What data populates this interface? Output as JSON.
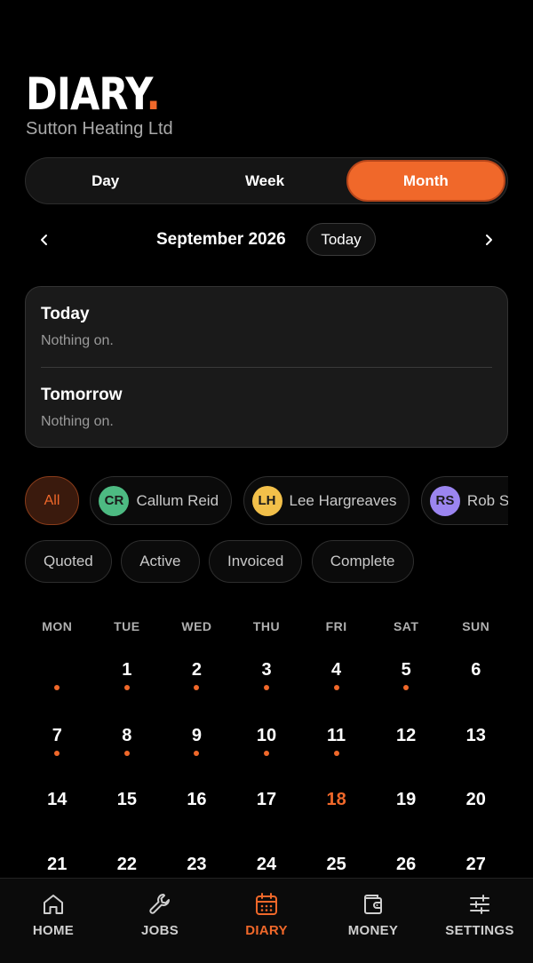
{
  "header": {
    "brand": "DIARY",
    "brand_dot": ".",
    "company": "Sutton Heating Ltd"
  },
  "view_toggle": {
    "options": [
      "Day",
      "Week",
      "Month"
    ],
    "active": "Month"
  },
  "month_nav": {
    "title": "September 2026",
    "today_label": "Today"
  },
  "summary": [
    {
      "label": "Today",
      "text": "Nothing on."
    },
    {
      "label": "Tomorrow",
      "text": "Nothing on."
    }
  ],
  "staff_filter": {
    "all_label": "All",
    "people": [
      {
        "initials": "CR",
        "name": "Callum Reid",
        "color": "#4dba82"
      },
      {
        "initials": "LH",
        "name": "Lee Hargreaves",
        "color": "#f2c04a"
      },
      {
        "initials": "RS",
        "name": "Rob Su",
        "color": "#9b85f0"
      }
    ]
  },
  "status_filter": [
    "Quoted",
    "Active",
    "Invoiced",
    "Complete"
  ],
  "calendar": {
    "weekdays": [
      "MON",
      "TUE",
      "WED",
      "THU",
      "FRI",
      "SAT",
      "SUN"
    ],
    "today": "18",
    "weeks": [
      [
        {
          "d": "",
          "ev": true
        },
        {
          "d": "1",
          "ev": true
        },
        {
          "d": "2",
          "ev": true
        },
        {
          "d": "3",
          "ev": true
        },
        {
          "d": "4",
          "ev": true
        },
        {
          "d": "5",
          "ev": true
        },
        {
          "d": "6",
          "ev": false
        }
      ],
      [
        {
          "d": "7",
          "ev": true
        },
        {
          "d": "8",
          "ev": true
        },
        {
          "d": "9",
          "ev": true
        },
        {
          "d": "10",
          "ev": true
        },
        {
          "d": "11",
          "ev": true
        },
        {
          "d": "12",
          "ev": false
        },
        {
          "d": "13",
          "ev": false
        }
      ],
      [
        {
          "d": "14",
          "ev": false
        },
        {
          "d": "15",
          "ev": false
        },
        {
          "d": "16",
          "ev": false
        },
        {
          "d": "17",
          "ev": false
        },
        {
          "d": "18",
          "ev": false
        },
        {
          "d": "19",
          "ev": false
        },
        {
          "d": "20",
          "ev": false
        }
      ],
      [
        {
          "d": "21",
          "ev": false
        },
        {
          "d": "22",
          "ev": false
        },
        {
          "d": "23",
          "ev": false
        },
        {
          "d": "24",
          "ev": false
        },
        {
          "d": "25",
          "ev": false
        },
        {
          "d": "26",
          "ev": false
        },
        {
          "d": "27",
          "ev": false
        }
      ]
    ]
  },
  "tabbar": {
    "items": [
      {
        "label": "HOME",
        "icon": "home-icon"
      },
      {
        "label": "JOBS",
        "icon": "wrench-icon"
      },
      {
        "label": "DIARY",
        "icon": "calendar-icon"
      },
      {
        "label": "MONEY",
        "icon": "wallet-icon"
      },
      {
        "label": "SETTINGS",
        "icon": "sliders-icon"
      }
    ],
    "active": "DIARY"
  },
  "colors": {
    "accent": "#f0682a",
    "background": "#000000",
    "card": "#1a1a1a"
  }
}
